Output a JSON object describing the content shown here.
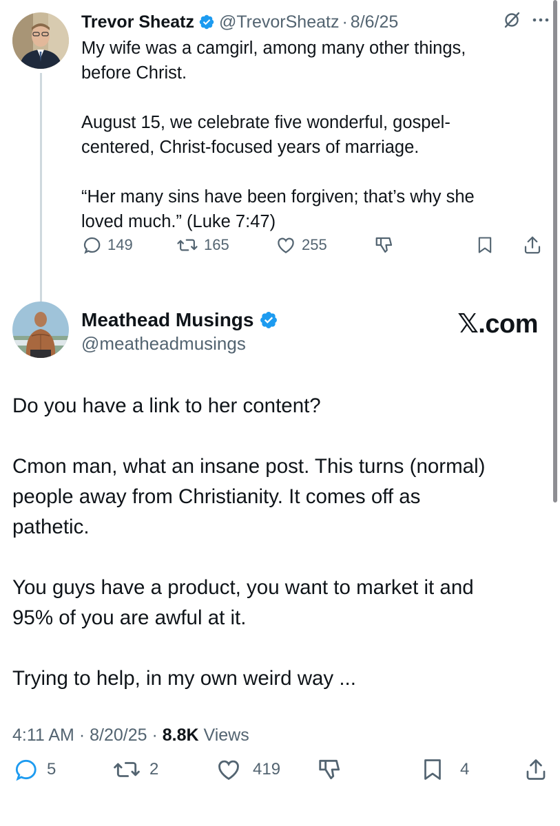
{
  "parent": {
    "name": "Trevor Sheatz",
    "handle": "@TrevorSheatz",
    "dot": "·",
    "date": "8/6/25",
    "text": "My wife was a camgirl, among many other things,\nbefore Christ.\n\nAugust 15, we celebrate five wonderful, gospel-\ncentered, Christ-focused years of marriage.\n\n“Her many sins have been forgiven; that’s why she\nloved much.” (Luke 7:47)",
    "actions": {
      "replies": "149",
      "reposts": "165",
      "likes": "255"
    }
  },
  "main": {
    "name": "Meathead Musings",
    "handle": "@meatheadmusings",
    "watermark": "𝕏.com",
    "text": "Do you have a link to her content?\n\nCmon man, what an insane post. This turns (normal)\npeople away from Christianity. It comes off as\npathetic.\n\nYou guys have a product, you want to market it and\n95% of you are awful at it.\n\nTrying to help, in my own weird way ...",
    "time": "4:11 AM",
    "sep": " · ",
    "date": "8/20/25",
    "views_count": "8.8K",
    "views_label": " Views",
    "actions": {
      "replies": "5",
      "reposts": "2",
      "likes": "419",
      "bookmarks": "4"
    }
  },
  "colors": {
    "verified": "#1d9bf0",
    "text": "#0f1419",
    "muted": "#536471",
    "thread_line": "#cfd9de"
  },
  "icons": [
    "verified-badge-icon",
    "grok-icon",
    "more-icon",
    "reply-icon",
    "repost-icon",
    "like-icon",
    "dislike-icon",
    "bookmark-icon",
    "share-icon"
  ]
}
